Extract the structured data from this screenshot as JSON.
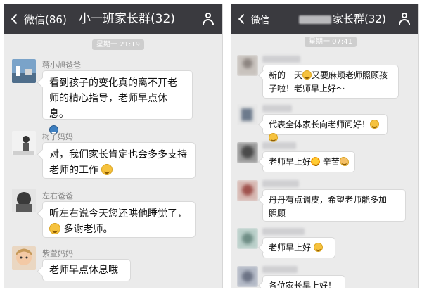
{
  "left": {
    "back_label": "微信(86)",
    "title": "小一班家长群(32)",
    "time": "星期一 21:19",
    "messages": [
      {
        "sender": "蒋小旭爸爸",
        "line1": "看到孩子的变化真的离不开老",
        "line2": "师的精心指导，老师早点休息。"
      },
      {
        "sender": "梅子妈妈",
        "line1": "对，我们家长肯定也会多多支持",
        "line2": "老师的工作"
      },
      {
        "sender": "左右爸爸",
        "line1": "听左右说今天您还哄他睡觉了，",
        "line2": "多谢老师。"
      },
      {
        "sender": "紫萱妈妈",
        "line1": "老师早点休息哦"
      }
    ]
  },
  "right": {
    "back_label": "微信",
    "title_suffix": "家长群(32)",
    "time": "星期一 07:41",
    "messages": [
      {
        "line1": "新的一天",
        "line1b": "又要麻烦老师照顾孩",
        "line2": "子啦！老师早上好～"
      },
      {
        "line1": "代表全体家长向老师问好！"
      },
      {
        "line1": "老师早上好",
        "line1b": "辛苦"
      },
      {
        "line1": "丹丹有点调皮，希望老师能多加",
        "line2": "照顾"
      },
      {
        "line1": "老师早上好"
      },
      {
        "line1": "各位家长早上好！"
      }
    ]
  },
  "colors": {
    "nav_bg": "#3a3a3f",
    "chat_bg": "#ebebeb",
    "bubble_bg": "#ffffff",
    "pill_bg": "#cecece"
  },
  "icons": {
    "back": "chevron-left-icon",
    "members": "person-icon"
  }
}
